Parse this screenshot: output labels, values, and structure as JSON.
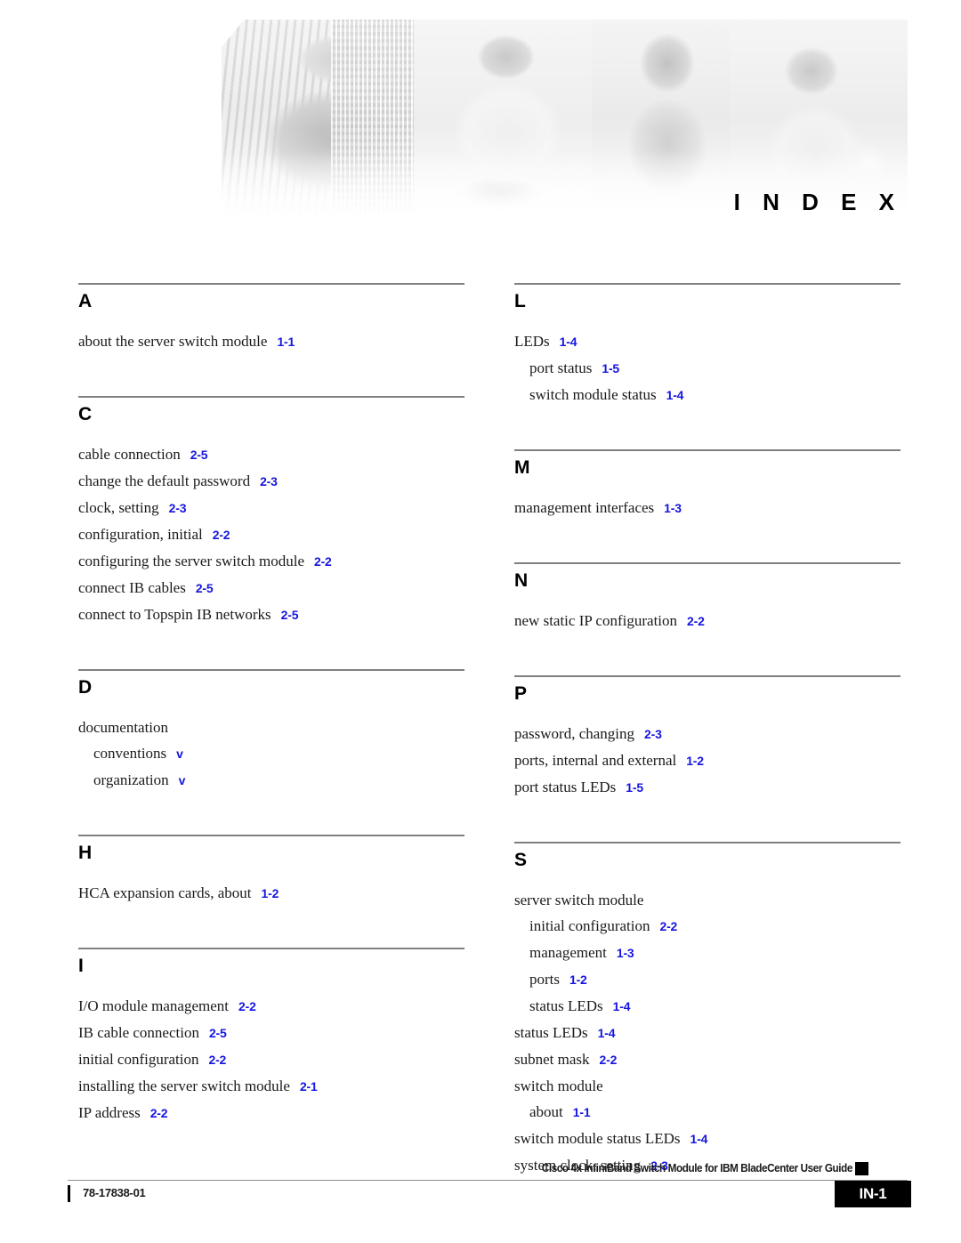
{
  "banner": {
    "title": "I N D E X",
    "title_plain": "INDEX"
  },
  "index": {
    "columns": [
      {
        "sections": [
          {
            "letter": "A",
            "entries": [
              {
                "text": "about the server switch module",
                "ref": "1-1",
                "level": 0
              }
            ]
          },
          {
            "letter": "C",
            "entries": [
              {
                "text": "cable connection",
                "ref": "2-5",
                "level": 0
              },
              {
                "text": "change the default password",
                "ref": "2-3",
                "level": 0
              },
              {
                "text": "clock, setting",
                "ref": "2-3",
                "level": 0
              },
              {
                "text": "configuration, initial",
                "ref": "2-2",
                "level": 0
              },
              {
                "text": "configuring the server switch module",
                "ref": "2-2",
                "level": 0
              },
              {
                "text": "connect IB cables",
                "ref": "2-5",
                "level": 0
              },
              {
                "text": "connect to Topspin IB networks",
                "ref": "2-5",
                "level": 0
              }
            ]
          },
          {
            "letter": "D",
            "entries": [
              {
                "text": "documentation",
                "ref": "",
                "level": 0
              },
              {
                "text": "conventions",
                "ref": "v",
                "level": 1
              },
              {
                "text": "organization",
                "ref": "v",
                "level": 1
              }
            ]
          },
          {
            "letter": "H",
            "entries": [
              {
                "text": "HCA expansion cards, about",
                "ref": "1-2",
                "level": 0
              }
            ]
          },
          {
            "letter": "I",
            "entries": [
              {
                "text": "I/O module management",
                "ref": "2-2",
                "level": 0
              },
              {
                "text": "IB cable connection",
                "ref": "2-5",
                "level": 0
              },
              {
                "text": "initial configuration",
                "ref": "2-2",
                "level": 0
              },
              {
                "text": "installing the server switch module",
                "ref": "2-1",
                "level": 0
              },
              {
                "text": "IP address",
                "ref": "2-2",
                "level": 0
              }
            ]
          }
        ]
      },
      {
        "sections": [
          {
            "letter": "L",
            "entries": [
              {
                "text": "LEDs",
                "ref": "1-4",
                "level": 0
              },
              {
                "text": "port status",
                "ref": "1-5",
                "level": 1
              },
              {
                "text": "switch module status",
                "ref": "1-4",
                "level": 1
              }
            ]
          },
          {
            "letter": "M",
            "entries": [
              {
                "text": "management interfaces",
                "ref": "1-3",
                "level": 0
              }
            ]
          },
          {
            "letter": "N",
            "entries": [
              {
                "text": "new static IP configuration",
                "ref": "2-2",
                "level": 0
              }
            ]
          },
          {
            "letter": "P",
            "entries": [
              {
                "text": "password, changing",
                "ref": "2-3",
                "level": 0
              },
              {
                "text": "ports, internal and external",
                "ref": "1-2",
                "level": 0
              },
              {
                "text": "port status LEDs",
                "ref": "1-5",
                "level": 0
              }
            ]
          },
          {
            "letter": "S",
            "entries": [
              {
                "text": "server switch module",
                "ref": "",
                "level": 0
              },
              {
                "text": "initial configuration",
                "ref": "2-2",
                "level": 1
              },
              {
                "text": "management",
                "ref": "1-3",
                "level": 1
              },
              {
                "text": "ports",
                "ref": "1-2",
                "level": 1
              },
              {
                "text": "status LEDs",
                "ref": "1-4",
                "level": 1
              },
              {
                "text": "status LEDs",
                "ref": "1-4",
                "level": 0
              },
              {
                "text": "subnet mask",
                "ref": "2-2",
                "level": 0
              },
              {
                "text": "switch module",
                "ref": "",
                "level": 0
              },
              {
                "text": "about",
                "ref": "1-1",
                "level": 1
              },
              {
                "text": "switch module status LEDs",
                "ref": "1-4",
                "level": 0
              },
              {
                "text": "system clock, setting",
                "ref": "2-3",
                "level": 0
              }
            ]
          }
        ]
      }
    ]
  },
  "footer": {
    "document_title": "Cisco 4x InfiniBand Switch Module for IBM BladeCenter User Guide",
    "document_number": "78-17838-01",
    "page_label": "IN-1"
  },
  "colors": {
    "page_reference": "#1515e0",
    "rule": "#808080",
    "footer_box": "#000000"
  }
}
